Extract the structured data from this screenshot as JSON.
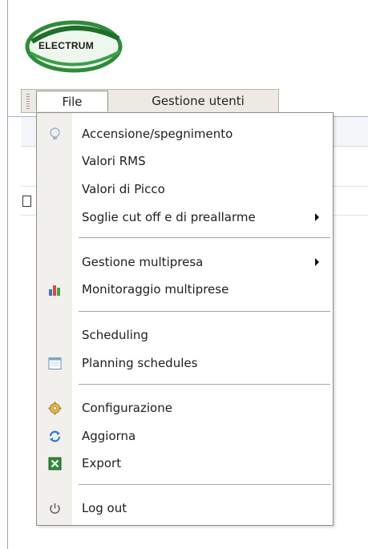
{
  "logo": {
    "text": "ELECTRUM",
    "colors": {
      "ring": "#2e8b3a",
      "highlight": "#eef7ee"
    }
  },
  "menubar": {
    "file_label": "File",
    "gestione_label": "Gestione utenti"
  },
  "dropdown": {
    "items": [
      {
        "label": "Accensione/spegnimento",
        "icon": "lightbulb-icon",
        "submenu": false
      },
      {
        "label": "Valori RMS",
        "icon": "",
        "submenu": false
      },
      {
        "label": "Valori di Picco",
        "icon": "",
        "submenu": false
      },
      {
        "label": "Soglie cut off e di preallarme",
        "icon": "",
        "submenu": true
      },
      {
        "label": "Gestione multipresa",
        "icon": "",
        "submenu": true
      },
      {
        "label": "Monitoraggio multiprese",
        "icon": "bar-chart-icon",
        "submenu": false
      },
      {
        "label": "Scheduling",
        "icon": "",
        "submenu": false
      },
      {
        "label": "Planning schedules",
        "icon": "calendar-icon",
        "submenu": false
      },
      {
        "label": "Configurazione",
        "icon": "gear-icon",
        "submenu": false
      },
      {
        "label": "Aggiorna",
        "icon": "refresh-icon",
        "submenu": false
      },
      {
        "label": "Export",
        "icon": "excel-icon",
        "submenu": false
      },
      {
        "label": "Log out",
        "icon": "power-icon",
        "submenu": false
      }
    ]
  }
}
